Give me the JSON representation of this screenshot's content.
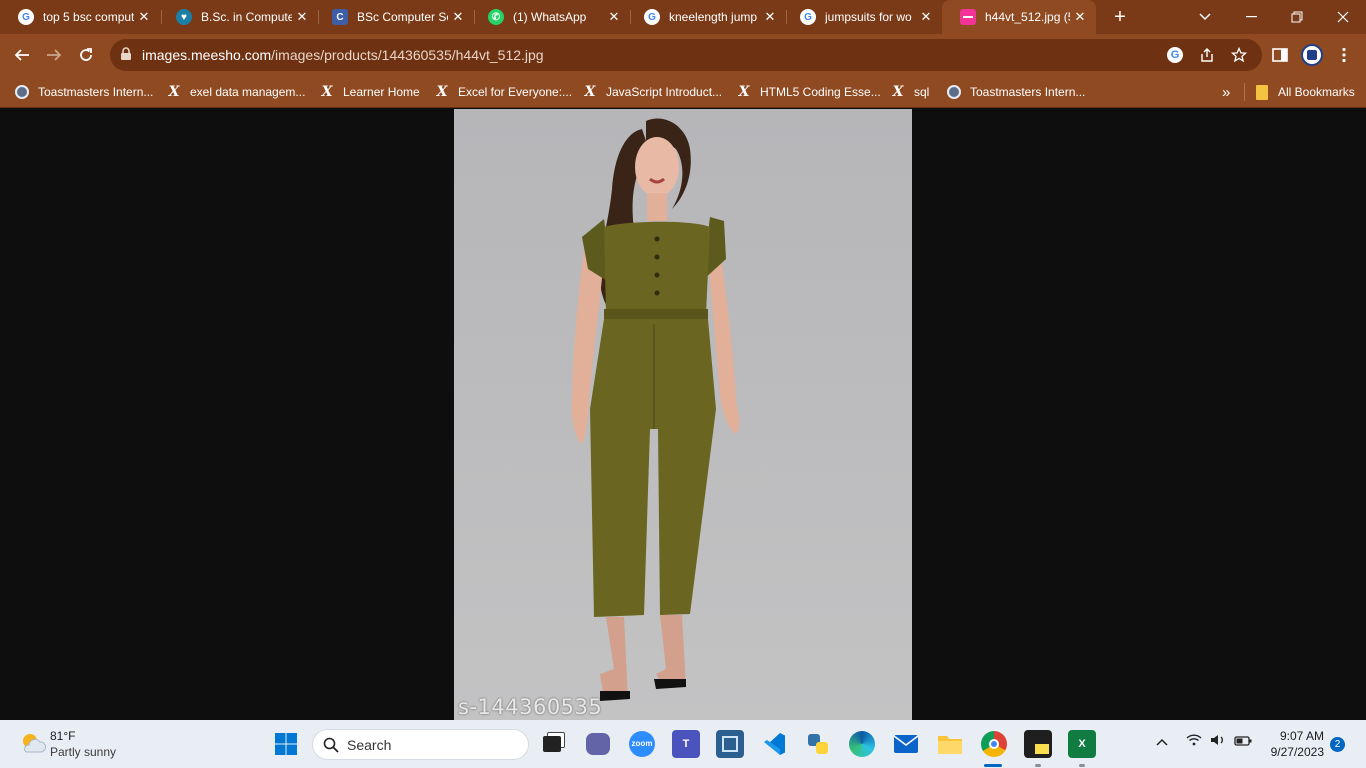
{
  "browser": {
    "tabs": [
      {
        "title": "top 5 bsc comput",
        "icon": "google-icon"
      },
      {
        "title": "B.Sc. in Compute",
        "icon": "site-icon"
      },
      {
        "title": "BSc Computer Sc",
        "icon": "c-icon"
      },
      {
        "title": "(1) WhatsApp",
        "icon": "whatsapp-icon"
      },
      {
        "title": "kneelength jump",
        "icon": "google-icon"
      },
      {
        "title": "jumpsuits for wo",
        "icon": "google-icon"
      },
      {
        "title": "h44vt_512.jpg (5",
        "icon": "meesho-icon"
      }
    ],
    "active_tab_index": 6,
    "url_host": "images.meesho.com",
    "url_path": "/images/products/144360535/h44vt_512.jpg",
    "bookmarks": [
      {
        "label": "Toastmasters Intern...",
        "icon": "globe-icon"
      },
      {
        "label": "exel data managem...",
        "icon": "x-icon"
      },
      {
        "label": "Learner Home",
        "icon": "x-icon"
      },
      {
        "label": "Excel for Everyone:...",
        "icon": "x-icon"
      },
      {
        "label": "JavaScript Introduct...",
        "icon": "x-icon"
      },
      {
        "label": "HTML5 Coding Esse...",
        "icon": "x-icon"
      },
      {
        "label": "sql",
        "icon": "x-icon"
      },
      {
        "label": "Toastmasters Intern...",
        "icon": "globe-icon"
      }
    ],
    "overflow_label": "»",
    "all_bookmarks_label": "All Bookmarks"
  },
  "image": {
    "watermark": "s-144360535"
  },
  "taskbar": {
    "weather_temp": "81°F",
    "weather_desc": "Partly sunny",
    "search_placeholder": "Search",
    "clock_time": "9:07 AM",
    "clock_date": "9/27/2023",
    "notification_count": "2"
  },
  "colors": {
    "frame": "#7a3a17",
    "toolbar": "#8f4a21",
    "omnibox": "#6e3212",
    "taskbar": "#e9eef5"
  }
}
